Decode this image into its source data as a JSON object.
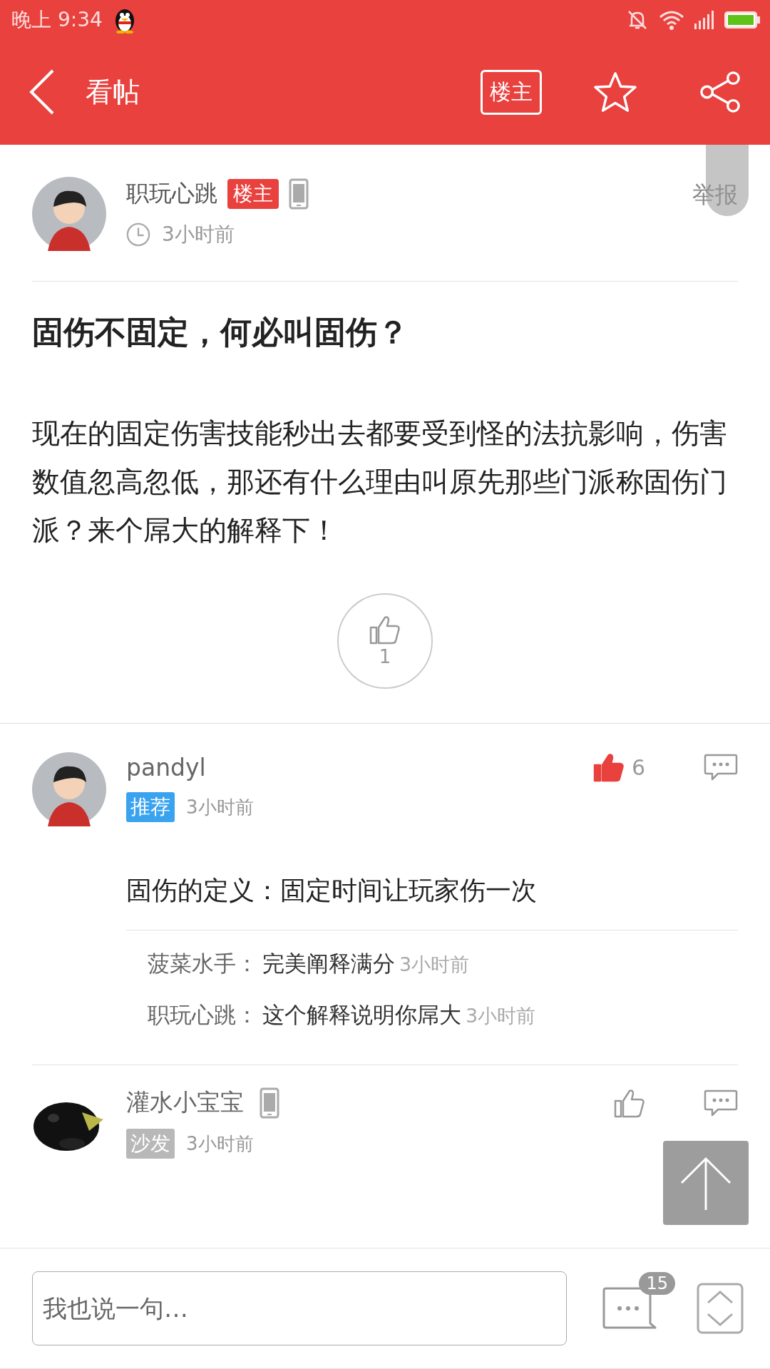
{
  "status_bar": {
    "time": "晚上 9:34"
  },
  "toolbar": {
    "title": "看帖",
    "filter_button": "楼主"
  },
  "post": {
    "author": "职玩心跳",
    "badge": "楼主",
    "on_mobile": true,
    "time": "3小时前",
    "report": "举报",
    "title": "固伤不固定，何必叫固伤？",
    "body": "现在的固定伤害技能秒出去都要受到怪的法抗影响，伤害数值忽高忽低，那还有什么理由叫原先那些门派称固伤门派？来个屌大的解释下！",
    "likes": "1"
  },
  "comments": [
    {
      "author": "pandyl",
      "avatar": {
        "kind": "avatar"
      },
      "on_mobile": false,
      "tag": {
        "label": "推荐",
        "kind": "recommended"
      },
      "time": "3小时前",
      "liked": true,
      "likes": "6",
      "body": "固伤的定义：固定时间让玩家伤一次",
      "replies": [
        {
          "author": "菠菜水手：",
          "text": "完美阐释满分",
          "time": "3小时前"
        },
        {
          "author": "职玩心跳：",
          "text": "这个解释说明你屌大",
          "time": "3小时前"
        }
      ]
    },
    {
      "author": "灌水小宝宝",
      "on_mobile": true,
      "tag": {
        "label": "沙发",
        "kind": "sofa"
      },
      "time": "3小时前",
      "liked": false
    }
  ],
  "bottom_bar": {
    "placeholder": "我也说一句…",
    "comment_count": "15"
  }
}
